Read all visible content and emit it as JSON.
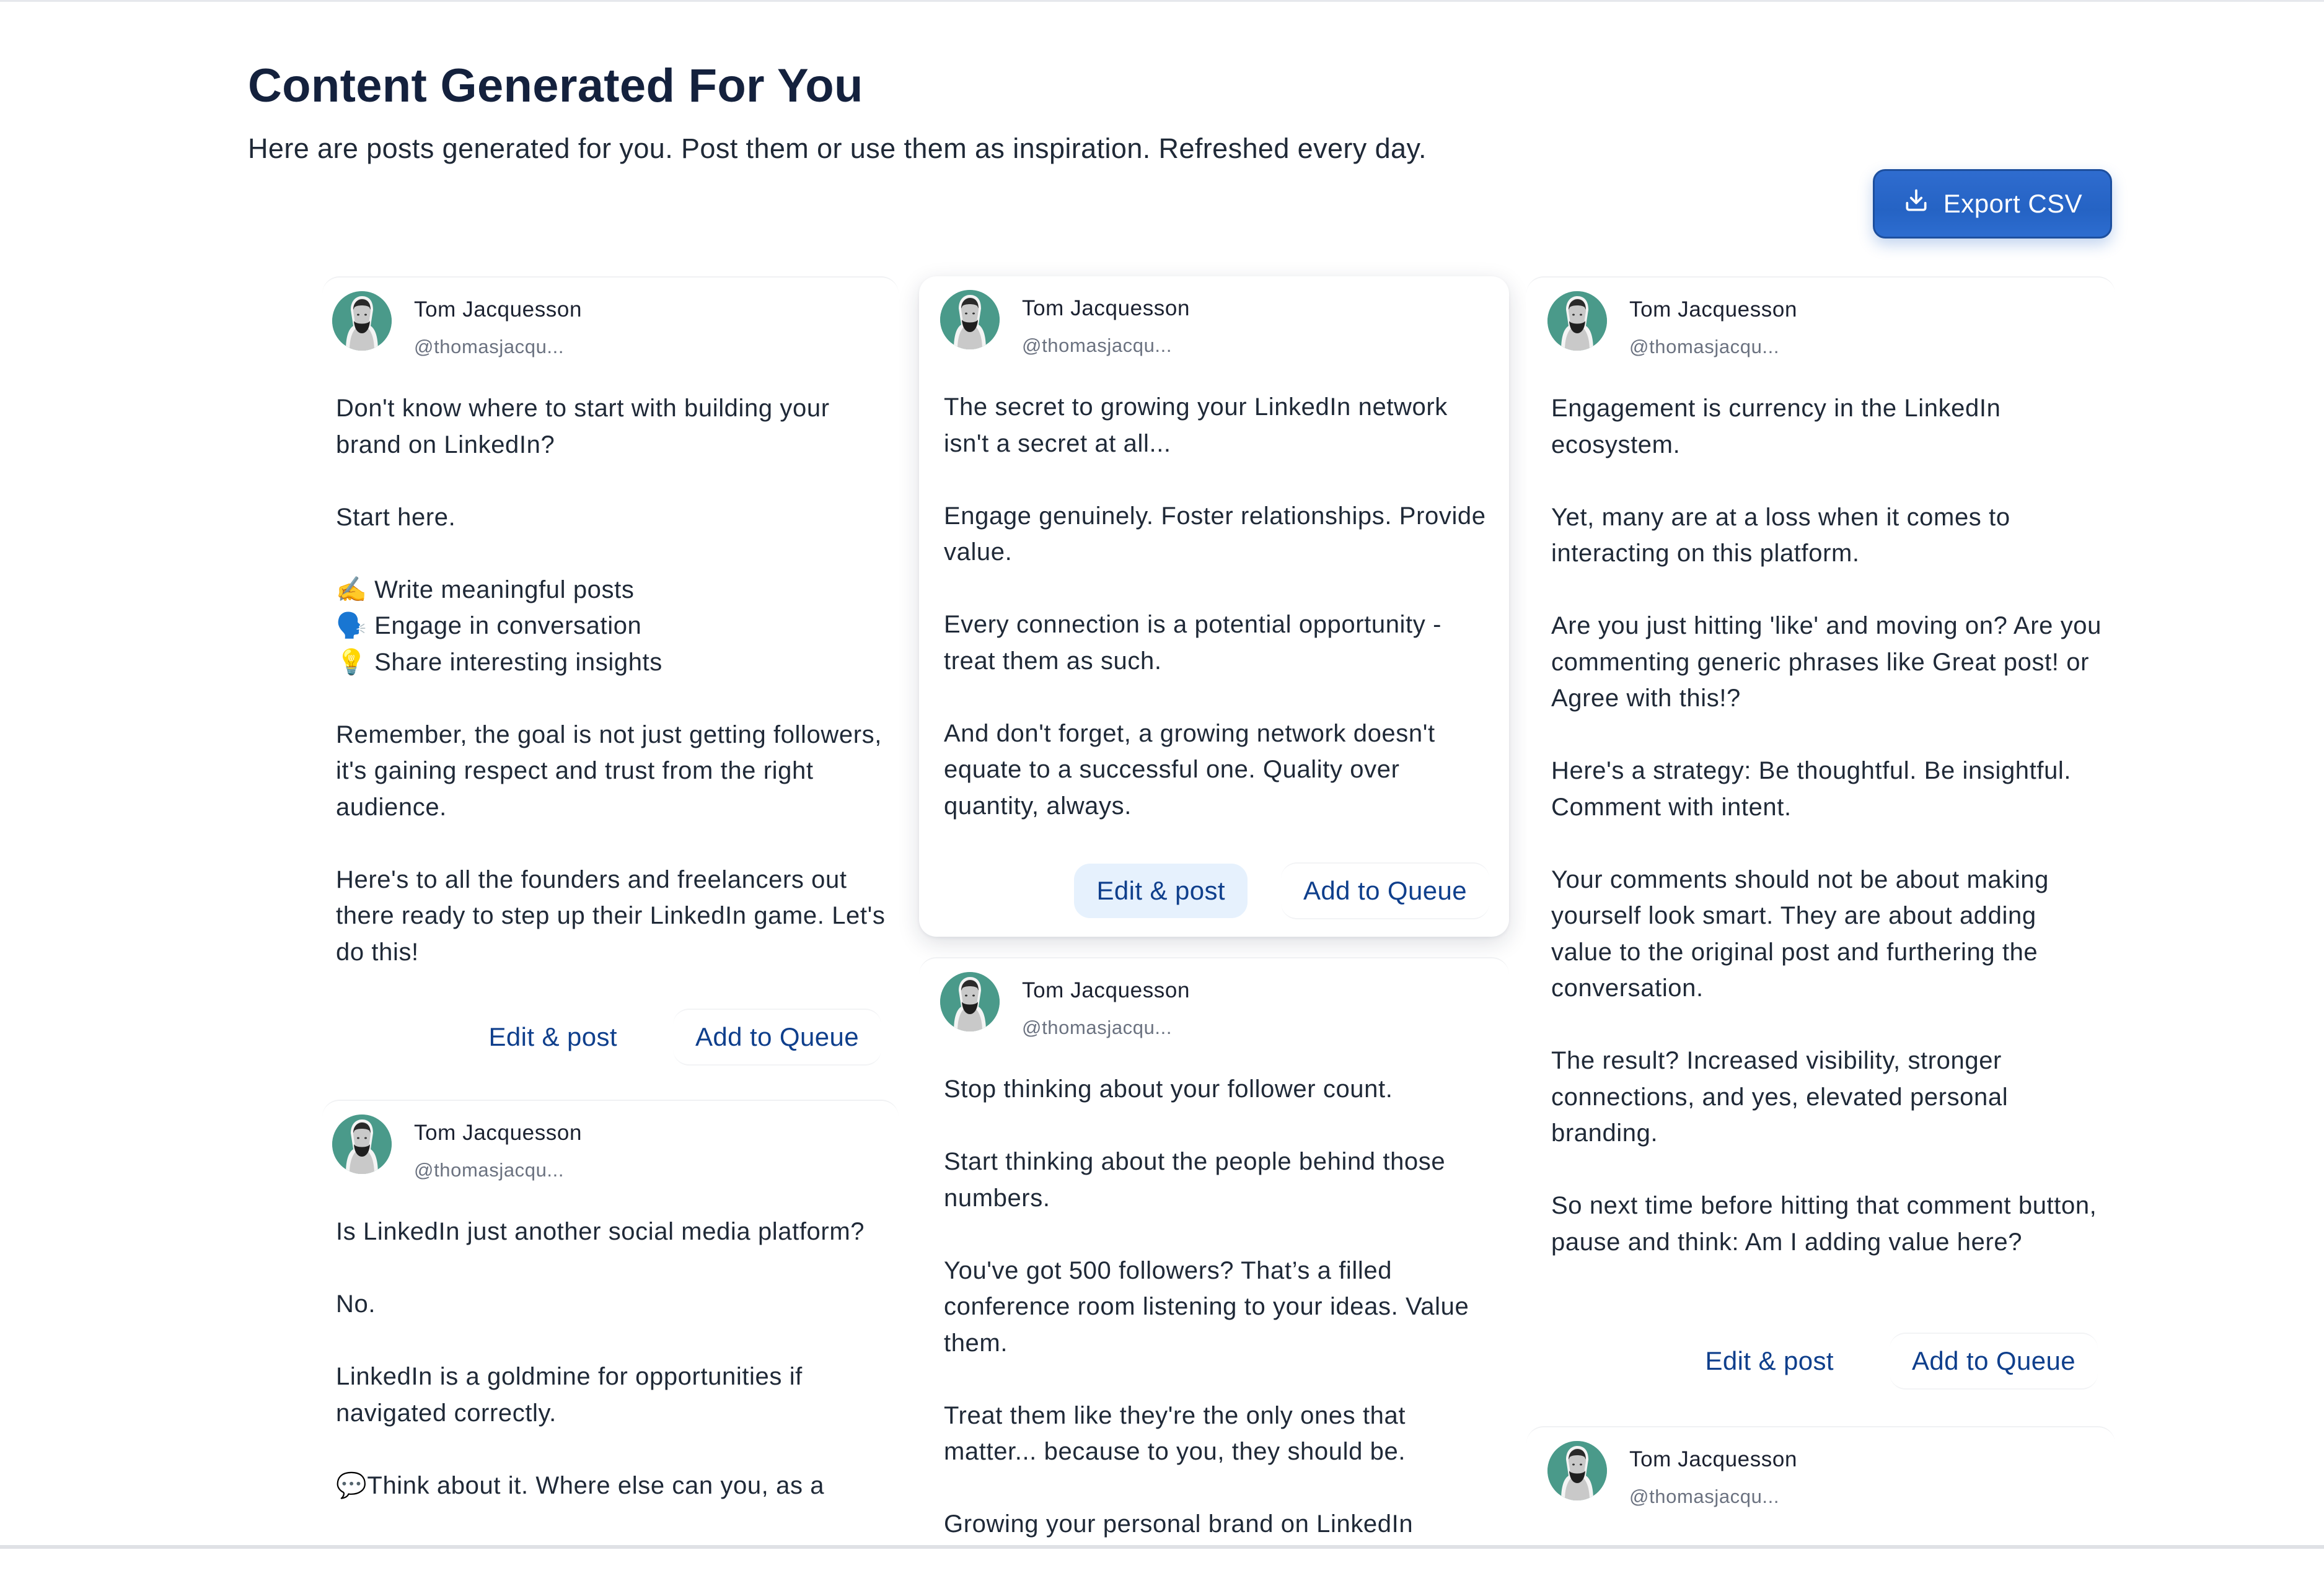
{
  "header": {
    "title": "Content Generated For You",
    "subtitle": "Here are posts generated for you. Post them or use them as inspiration. Refreshed every day.",
    "export_label": "Export CSV",
    "export_icon": "download-tray-icon"
  },
  "colors": {
    "accent": "#2563c4",
    "button_text": "#0f3f8c",
    "hover_button_bg": "#e6f1fd",
    "avatar_bg": "#4a9a8a"
  },
  "actions": {
    "edit_label": "Edit & post",
    "queue_label": "Add to Queue"
  },
  "posts": [
    {
      "author": "Tom Jacquesson",
      "handle": "@thomasjacqu...",
      "body": "Don't know where to start with building your brand on LinkedIn?\n\nStart here.\n\n✍️ Write meaningful posts\n🗣️ Engage in conversation\n💡 Share interesting insights\n\nRemember, the goal is not just getting followers, it's gaining respect and trust from the right audience.\n\nHere's to all the founders and freelancers out there ready to step up their LinkedIn game. Let's do this!"
    },
    {
      "author": "Tom Jacquesson",
      "handle": "@thomasjacqu...",
      "body": "Is LinkedIn just another social media platform?\n\nNo.\n\nLinkedIn is a goldmine for opportunities if navigated correctly.\n\n💬Think about it. Where else can you, as a"
    },
    {
      "author": "Tom Jacquesson",
      "handle": "@thomasjacqu...",
      "body": "The secret to growing your LinkedIn network isn't a secret at all...\n\nEngage genuinely. Foster relationships. Provide value.\n\nEvery connection is a potential opportunity - treat them as such.\n\nAnd don't forget, a growing network doesn't equate to a successful one. Quality over quantity, always."
    },
    {
      "author": "Tom Jacquesson",
      "handle": "@thomasjacqu...",
      "body": "Stop thinking about your follower count.\n\nStart thinking about the people behind those numbers.\n\nYou've got 500 followers? That’s a filled conference room listening to your ideas. Value them.\n\nTreat them like they're the only ones that matter... because to you, they should be.\n\nGrowing your personal brand on LinkedIn"
    },
    {
      "author": "Tom Jacquesson",
      "handle": "@thomasjacqu...",
      "body": "Engagement is currency in the LinkedIn ecosystem.\n\nYet, many are at a loss when it comes to interacting on this platform.\n\nAre you just hitting 'like' and moving on? Are you commenting generic phrases like Great post! or Agree with this!?\n\nHere's a strategy: Be thoughtful. Be insightful. Comment with intent.\n\nYour comments should not be about making yourself look smart. They are about adding value to the original post and furthering the conversation.\n\nThe result? Increased visibility, stronger connections, and yes, elevated personal branding.\n\nSo next time before hitting that comment button, pause and think: Am I adding value here?"
    },
    {
      "author": "Tom Jacquesson",
      "handle": "@thomasjacqu...",
      "body": ""
    }
  ]
}
